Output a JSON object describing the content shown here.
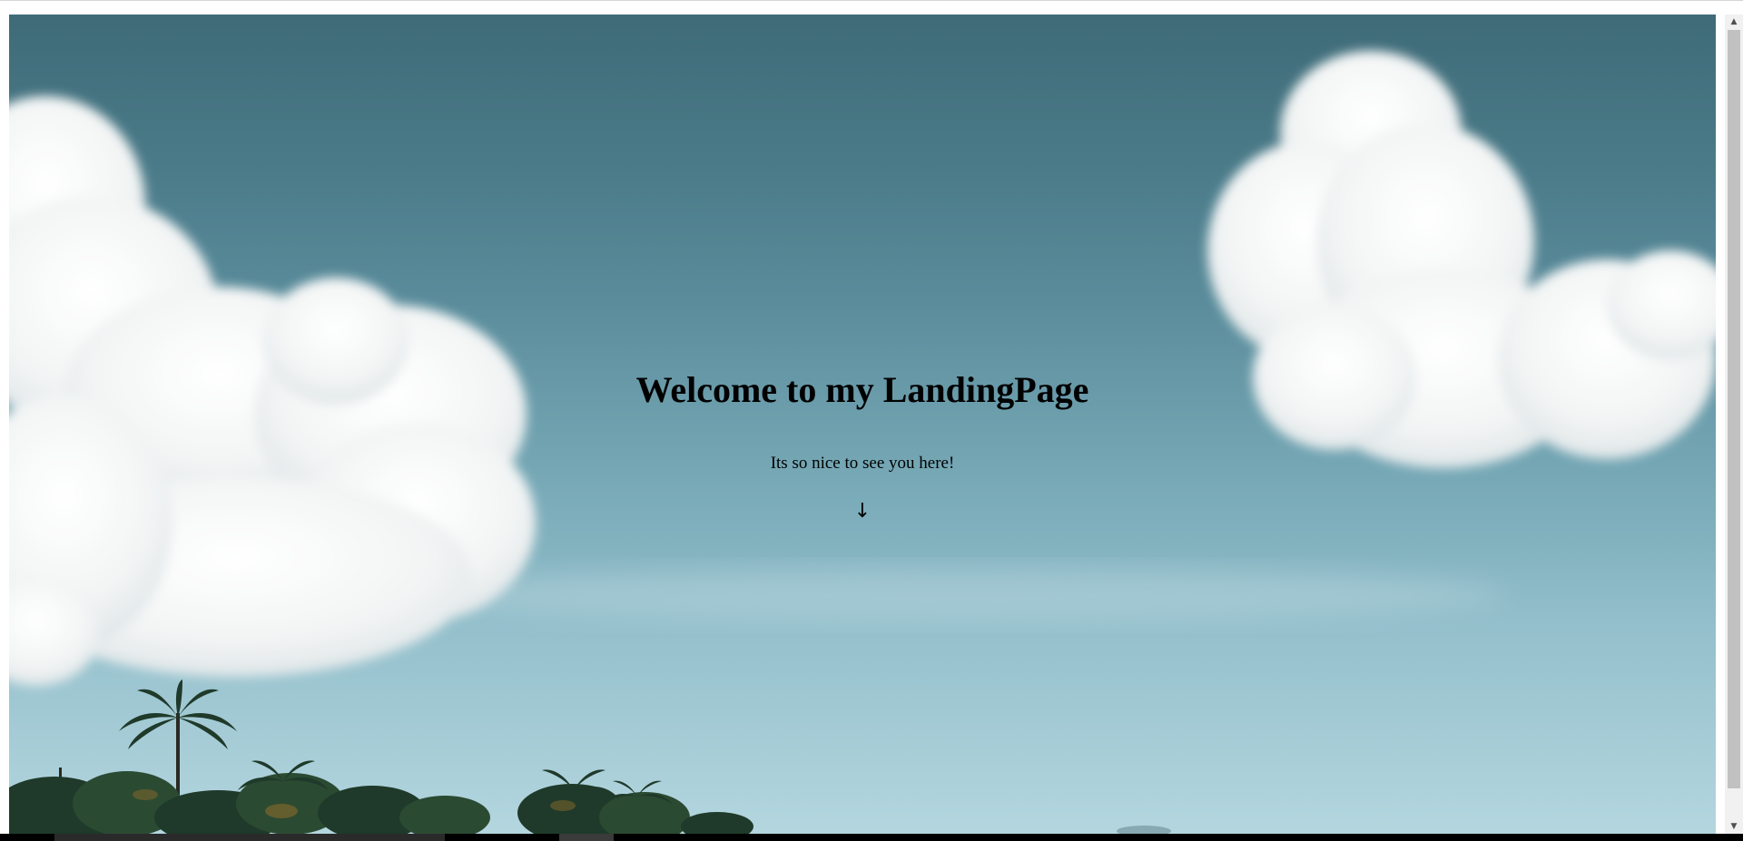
{
  "hero": {
    "title": "Welcome to my LandingPage",
    "subtitle": "Its so nice to see you here!",
    "scroll_arrow": "↓"
  },
  "scrollbar": {
    "up_arrow": "▲",
    "down_arrow": "▼"
  },
  "colors": {
    "sky_top": "#3f6b78",
    "sky_bottom": "#b4d6df",
    "cloud": "#ffffff",
    "text": "#000000"
  }
}
